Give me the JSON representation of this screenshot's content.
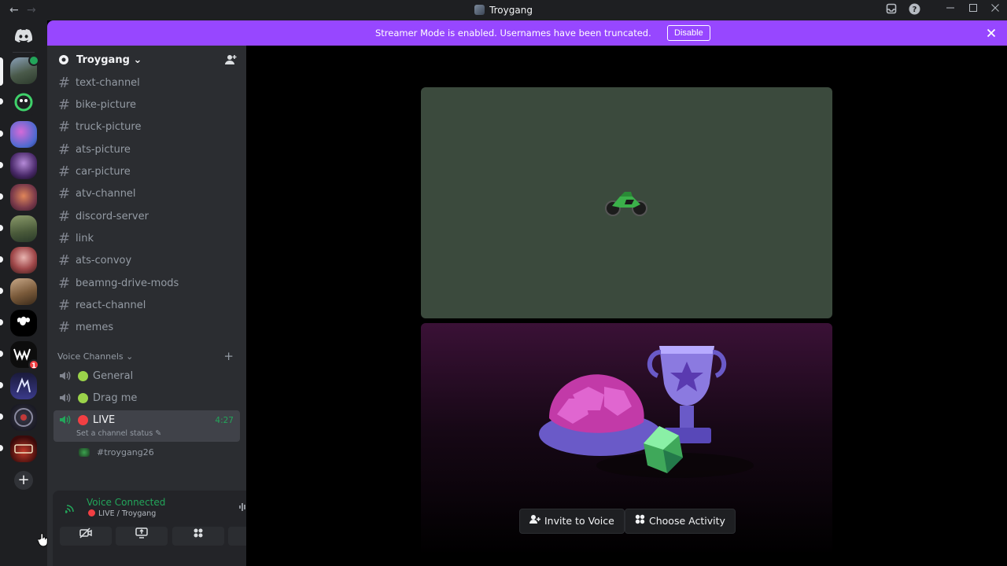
{
  "window": {
    "title": "Troygang",
    "back": "←",
    "forward": "→"
  },
  "banner": {
    "message": "Streamer Mode is enabled. Usernames have been truncated.",
    "disable_label": "Disable",
    "close": "✕"
  },
  "guild": {
    "name": "Troygang",
    "chevron": "⌄"
  },
  "text_channels": [
    {
      "name": "text-channel"
    },
    {
      "name": "bike-picture"
    },
    {
      "name": "truck-picture"
    },
    {
      "name": "ats-picture"
    },
    {
      "name": "car-picture"
    },
    {
      "name": "atv-channel"
    },
    {
      "name": "discord-server"
    },
    {
      "name": "link"
    },
    {
      "name": "ats-convoy"
    },
    {
      "name": "beamng-drive-mods"
    },
    {
      "name": "react-channel"
    },
    {
      "name": "memes"
    }
  ],
  "voice_category": {
    "label": "Voice Channels",
    "chevron": "⌄",
    "add": "+"
  },
  "voice_channels": [
    {
      "name": "General",
      "emoji_color": "#9bd34a"
    },
    {
      "name": "Drag me",
      "emoji_color": "#9bd34a"
    },
    {
      "name": "LIVE",
      "emoji_color": "#f23f43",
      "time": "4:27",
      "status": "Set a channel status ✎"
    }
  ],
  "voice_member": {
    "name": "#troygang26"
  },
  "voice_panel": {
    "connected_label": "Voice Connected",
    "channel_path": "LIVE / Troygang"
  },
  "server_badges": {
    "mention_count": "1"
  },
  "activity_buttons": {
    "invite_label": "Invite to Voice",
    "choose_label": "Choose Activity"
  },
  "colors": {
    "streamer_banner": "#9747ff",
    "voice_green": "#23a55a",
    "live_red": "#f23f43"
  }
}
